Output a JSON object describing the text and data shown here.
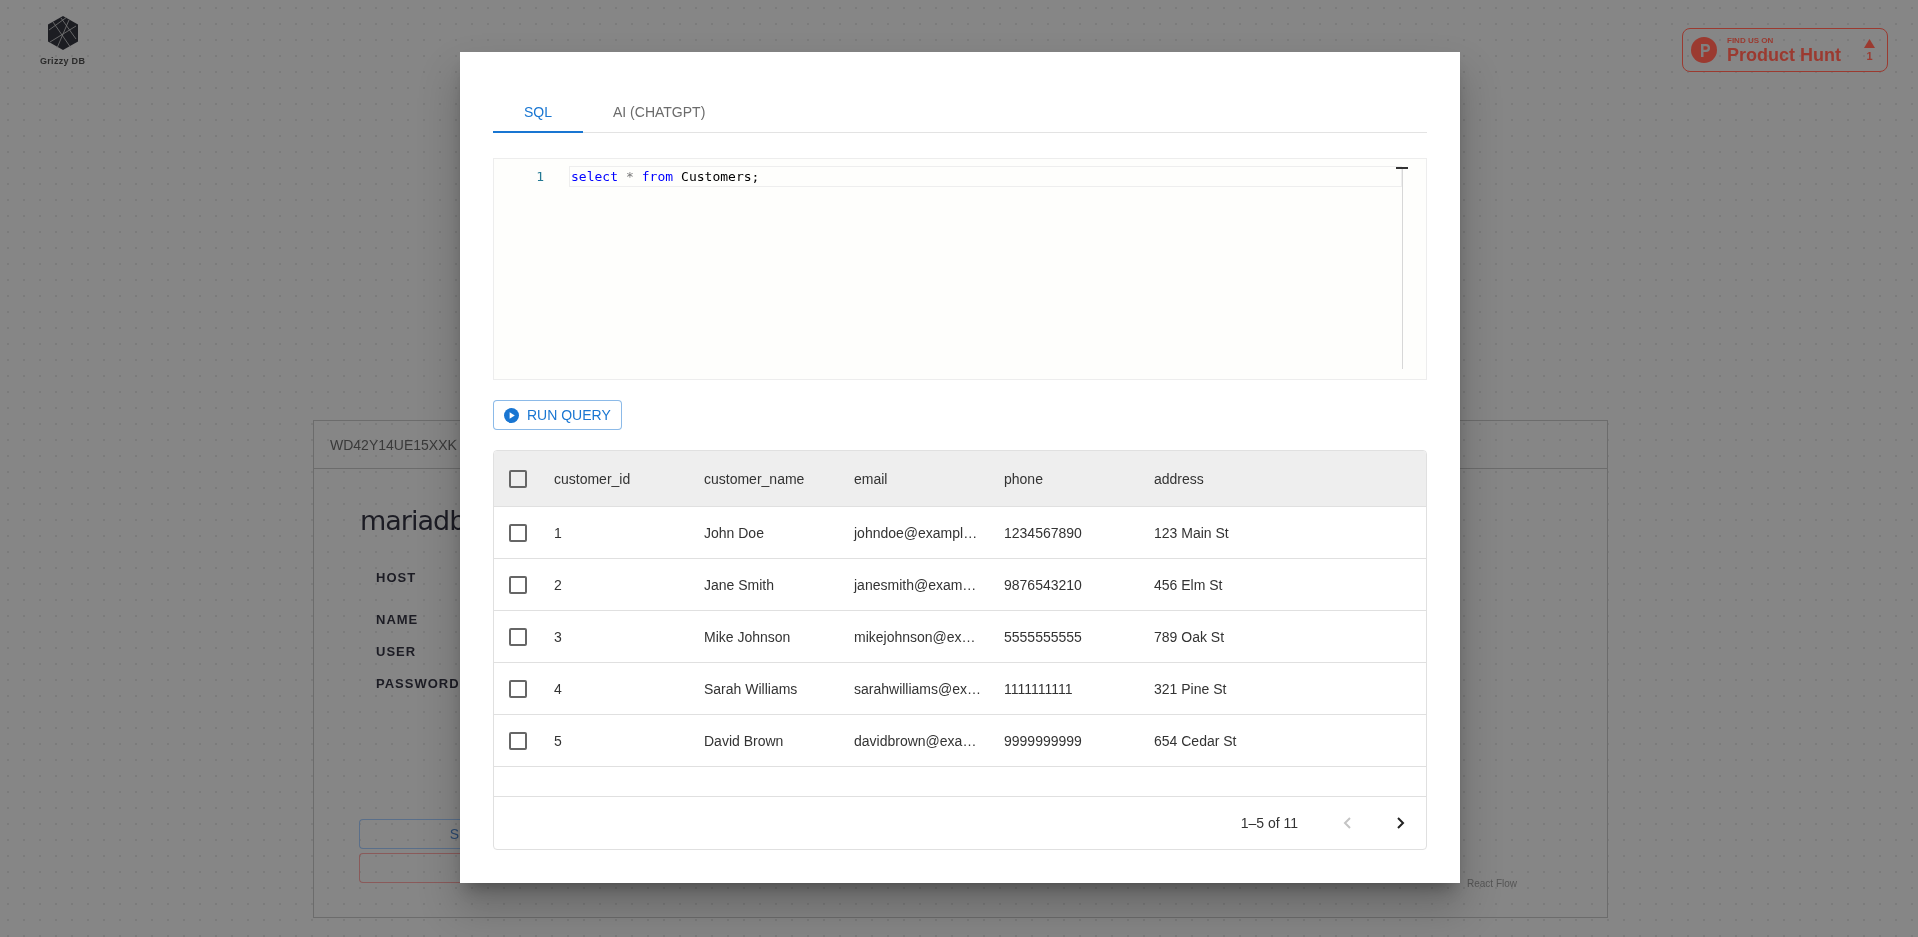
{
  "logo": {
    "text": "Grizzy DB"
  },
  "product_hunt": {
    "eyebrow": "FIND US ON",
    "name": "Product Hunt",
    "votes": "1"
  },
  "background_card": {
    "id": "WD42Y14UE15XXK",
    "title": "mariadb",
    "fields": [
      "HOST",
      "NAME",
      "USER",
      "PASSWORD"
    ],
    "buttons": [
      {
        "kind": "primary",
        "label": "S"
      },
      {
        "kind": "danger"
      }
    ]
  },
  "attribution": "React Flow",
  "modal": {
    "tabs": [
      {
        "label": "SQL",
        "selected": true
      },
      {
        "label": "AI (CHATGPT)",
        "selected": false
      }
    ],
    "editor": {
      "lines": [
        {
          "number": "1",
          "tokens": [
            {
              "kind": "keyword",
              "text": "select"
            },
            {
              "kind": "operator",
              "text": "*"
            },
            {
              "kind": "keyword",
              "text": "from"
            },
            {
              "kind": "plain",
              "text": "Customers;"
            }
          ]
        }
      ]
    },
    "run_button": "RUN QUERY",
    "table": {
      "header_checked": false,
      "columns": [
        "customer_id",
        "customer_name",
        "email",
        "phone",
        "address"
      ],
      "rows": [
        {
          "selected": false,
          "cells": [
            "1",
            "John Doe",
            "johndoe@exampl…",
            "1234567890",
            "123 Main St"
          ]
        },
        {
          "selected": false,
          "cells": [
            "2",
            "Jane Smith",
            "janesmith@exam…",
            "9876543210",
            "456 Elm St"
          ]
        },
        {
          "selected": false,
          "cells": [
            "3",
            "Mike Johnson",
            "mikejohnson@ex…",
            "5555555555",
            "789 Oak St"
          ]
        },
        {
          "selected": false,
          "cells": [
            "4",
            "Sarah Williams",
            "sarahwilliams@ex…",
            "1111111111",
            "321 Pine St"
          ]
        },
        {
          "selected": false,
          "cells": [
            "5",
            "David Brown",
            "davidbrown@exa…",
            "9999999999",
            "654 Cedar St"
          ]
        }
      ],
      "pagination": {
        "range": "1–5 of 11",
        "prev_disabled": true,
        "next_disabled": false
      }
    }
  }
}
